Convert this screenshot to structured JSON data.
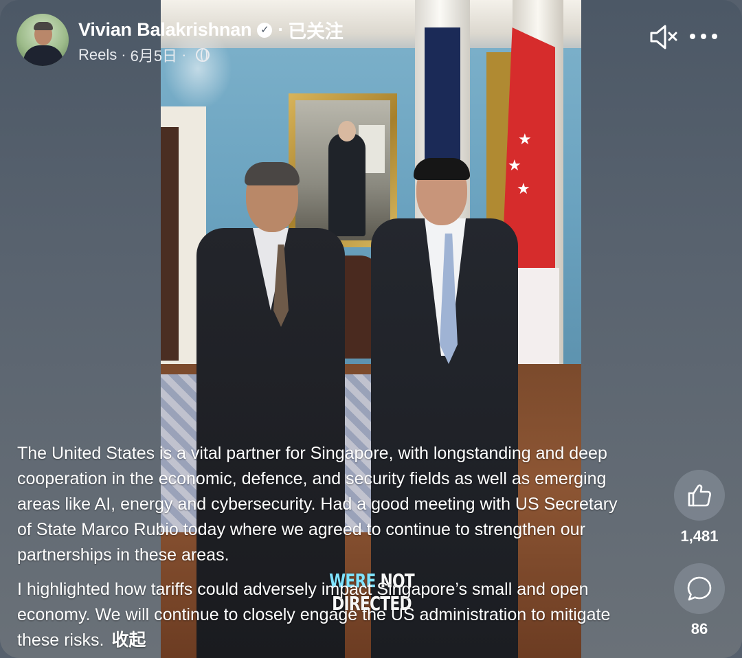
{
  "header": {
    "author_name": "Vivian Balakrishnan",
    "dot": "·",
    "follow_status": "已关注",
    "source": "Reels",
    "separator": "·",
    "date": "6月5日"
  },
  "video": {
    "caption_part1": "WERE",
    "caption_part2": "NOT DIRECTED"
  },
  "post": {
    "paragraph1": "The United States is a vital partner for Singapore, with longstanding and deep cooperation in the economic, defence, and security fields as well as emerging areas like AI, energy and cybersecurity. Had a good meeting with US Secretary of State Marco Rubio today where we agreed to continue to strengthen our partnerships in these areas.",
    "paragraph2": "I highlighted how tariffs could adversely impact Singapore’s small and open economy. We will continue to closely engage the US administration to mitigate these risks.",
    "collapse_label": "收起"
  },
  "actions": {
    "like_count": "1,481",
    "comment_count": "86"
  },
  "icons": {
    "verified": "verified-badge-icon",
    "globe": "globe-icon",
    "mute": "speaker-muted-icon",
    "more": "more-dots-icon",
    "like": "thumbs-up-icon",
    "comment": "comment-bubble-icon"
  },
  "colors": {
    "background": "#56606d",
    "text": "#ffffff",
    "caption_accent": "#7fe3ff"
  }
}
